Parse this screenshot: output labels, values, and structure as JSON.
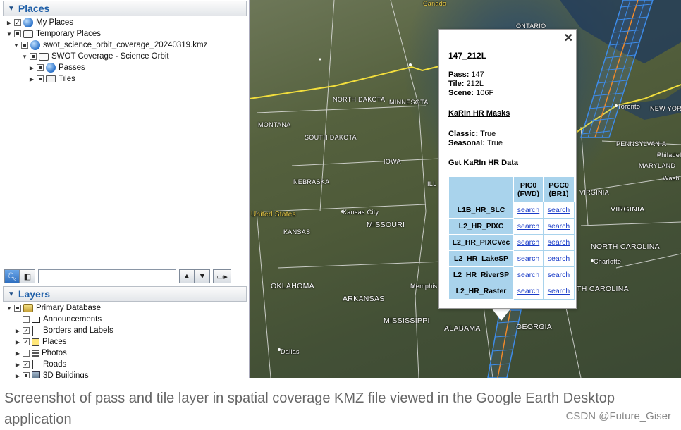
{
  "places": {
    "header": "Places",
    "items": [
      {
        "label": "My Places"
      },
      {
        "label": "Temporary Places"
      },
      {
        "label": "swot_science_orbit_coverage_20240319.kmz"
      },
      {
        "label": "SWOT Coverage - Science Orbit"
      },
      {
        "label": "Passes"
      },
      {
        "label": "Tiles"
      }
    ]
  },
  "layers": {
    "header": "Layers",
    "items": [
      {
        "label": "Primary Database"
      },
      {
        "label": "Announcements"
      },
      {
        "label": "Borders and Labels"
      },
      {
        "label": "Places"
      },
      {
        "label": "Photos"
      },
      {
        "label": "Roads"
      },
      {
        "label": "3D Buildings"
      }
    ]
  },
  "search": {
    "value": ""
  },
  "map_labels": {
    "canada": "Canada",
    "ontario": "ONTARIO",
    "north_dakota": "NORTH DAKOTA",
    "minnesota": "MINNESOTA",
    "montana": "MONTANA",
    "south_dakota": "SOUTH DAKOTA",
    "iowa": "IOWA",
    "nebraska": "NEBRASKA",
    "ill": "ILL",
    "united_states": "United States",
    "kansas_city": "Kansas City",
    "missouri": "MISSOURI",
    "kansas": "KANSAS",
    "oklahoma": "OKLAHOMA",
    "memphis": "Memphis",
    "arkansas": "ARKANSAS",
    "mississippi": "MISSISSIPPI",
    "alabama": "ALABAMA",
    "georgia": "GEORGIA",
    "dallas": "Dallas",
    "toronto": "Toronto",
    "new_york": "NEW YORK",
    "pennsylvania": "PENNSYLVANIA",
    "philadelphia": "Philadelph",
    "maryland": "MARYLAND",
    "washington": "Wash",
    "virginia_w": "VIRGINIA",
    "virginia": "VIRGINIA",
    "north_carolina": "NORTH CAROLINA",
    "charlotte": "Charlotte",
    "south_carolina": "TH CAROLINA"
  },
  "balloon": {
    "title": "147_212L",
    "pass_label": "Pass:",
    "pass_value": "147",
    "tile_label": "Tile:",
    "tile_value": "212L",
    "scene_label": "Scene:",
    "scene_value": "106F",
    "masks_link": "KaRIn HR Masks",
    "classic_label": "Classic:",
    "classic_value": "True",
    "seasonal_label": "Seasonal:",
    "seasonal_value": "True",
    "data_link": "Get KaRIn HR Data",
    "table": {
      "col1": "PIC0\n(FWD)",
      "col1_a": "PIC0",
      "col1_b": "(FWD)",
      "col2_a": "PGC0",
      "col2_b": "(BR1)",
      "rows": [
        {
          "product": "L1B_HR_SLC",
          "a": "search",
          "b": "search"
        },
        {
          "product": "L2_HR_PIXC",
          "a": "search",
          "b": "search"
        },
        {
          "product": "L2_HR_PIXCVec",
          "a": "search",
          "b": "search"
        },
        {
          "product": "L2_HR_LakeSP",
          "a": "search",
          "b": "search"
        },
        {
          "product": "L2_HR_RiverSP",
          "a": "search",
          "b": "search"
        },
        {
          "product": "L2_HR_Raster",
          "a": "search",
          "b": "search"
        }
      ]
    }
  },
  "caption": "Screenshot of pass and tile layer in spatial coverage KMZ file viewed in the Google Earth Desktop application",
  "watermark": "CSDN @Future_Giser"
}
